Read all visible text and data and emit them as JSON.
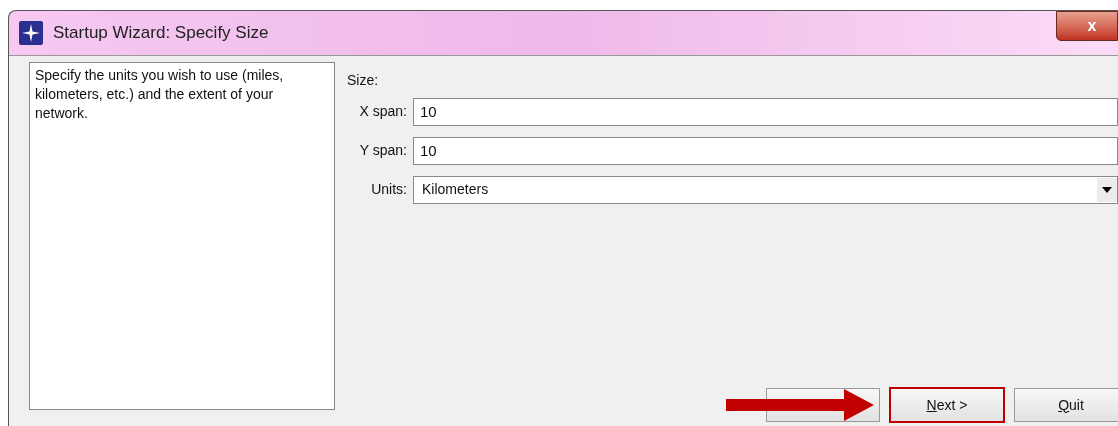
{
  "window": {
    "title": "Startup Wizard: Specify Size",
    "close": "x"
  },
  "description": "Specify the units you wish to use (miles, kilometers, etc.) and  the extent of your network.",
  "size_label": "Size:",
  "fields": [
    {
      "label": "X span:",
      "value": "10",
      "kind": "text"
    },
    {
      "label": "Y span:",
      "value": "10",
      "kind": "text"
    },
    {
      "label": "Units:",
      "value": "Kilometers",
      "kind": "dropdown"
    }
  ],
  "buttons": [
    {
      "highlighted": false
    },
    {
      "mnemonic": "N",
      "rest": "ext >",
      "highlighted": true,
      "arrow": true
    },
    {
      "mnemonic": "Q",
      "rest": "uit",
      "highlighted": false
    }
  ]
}
